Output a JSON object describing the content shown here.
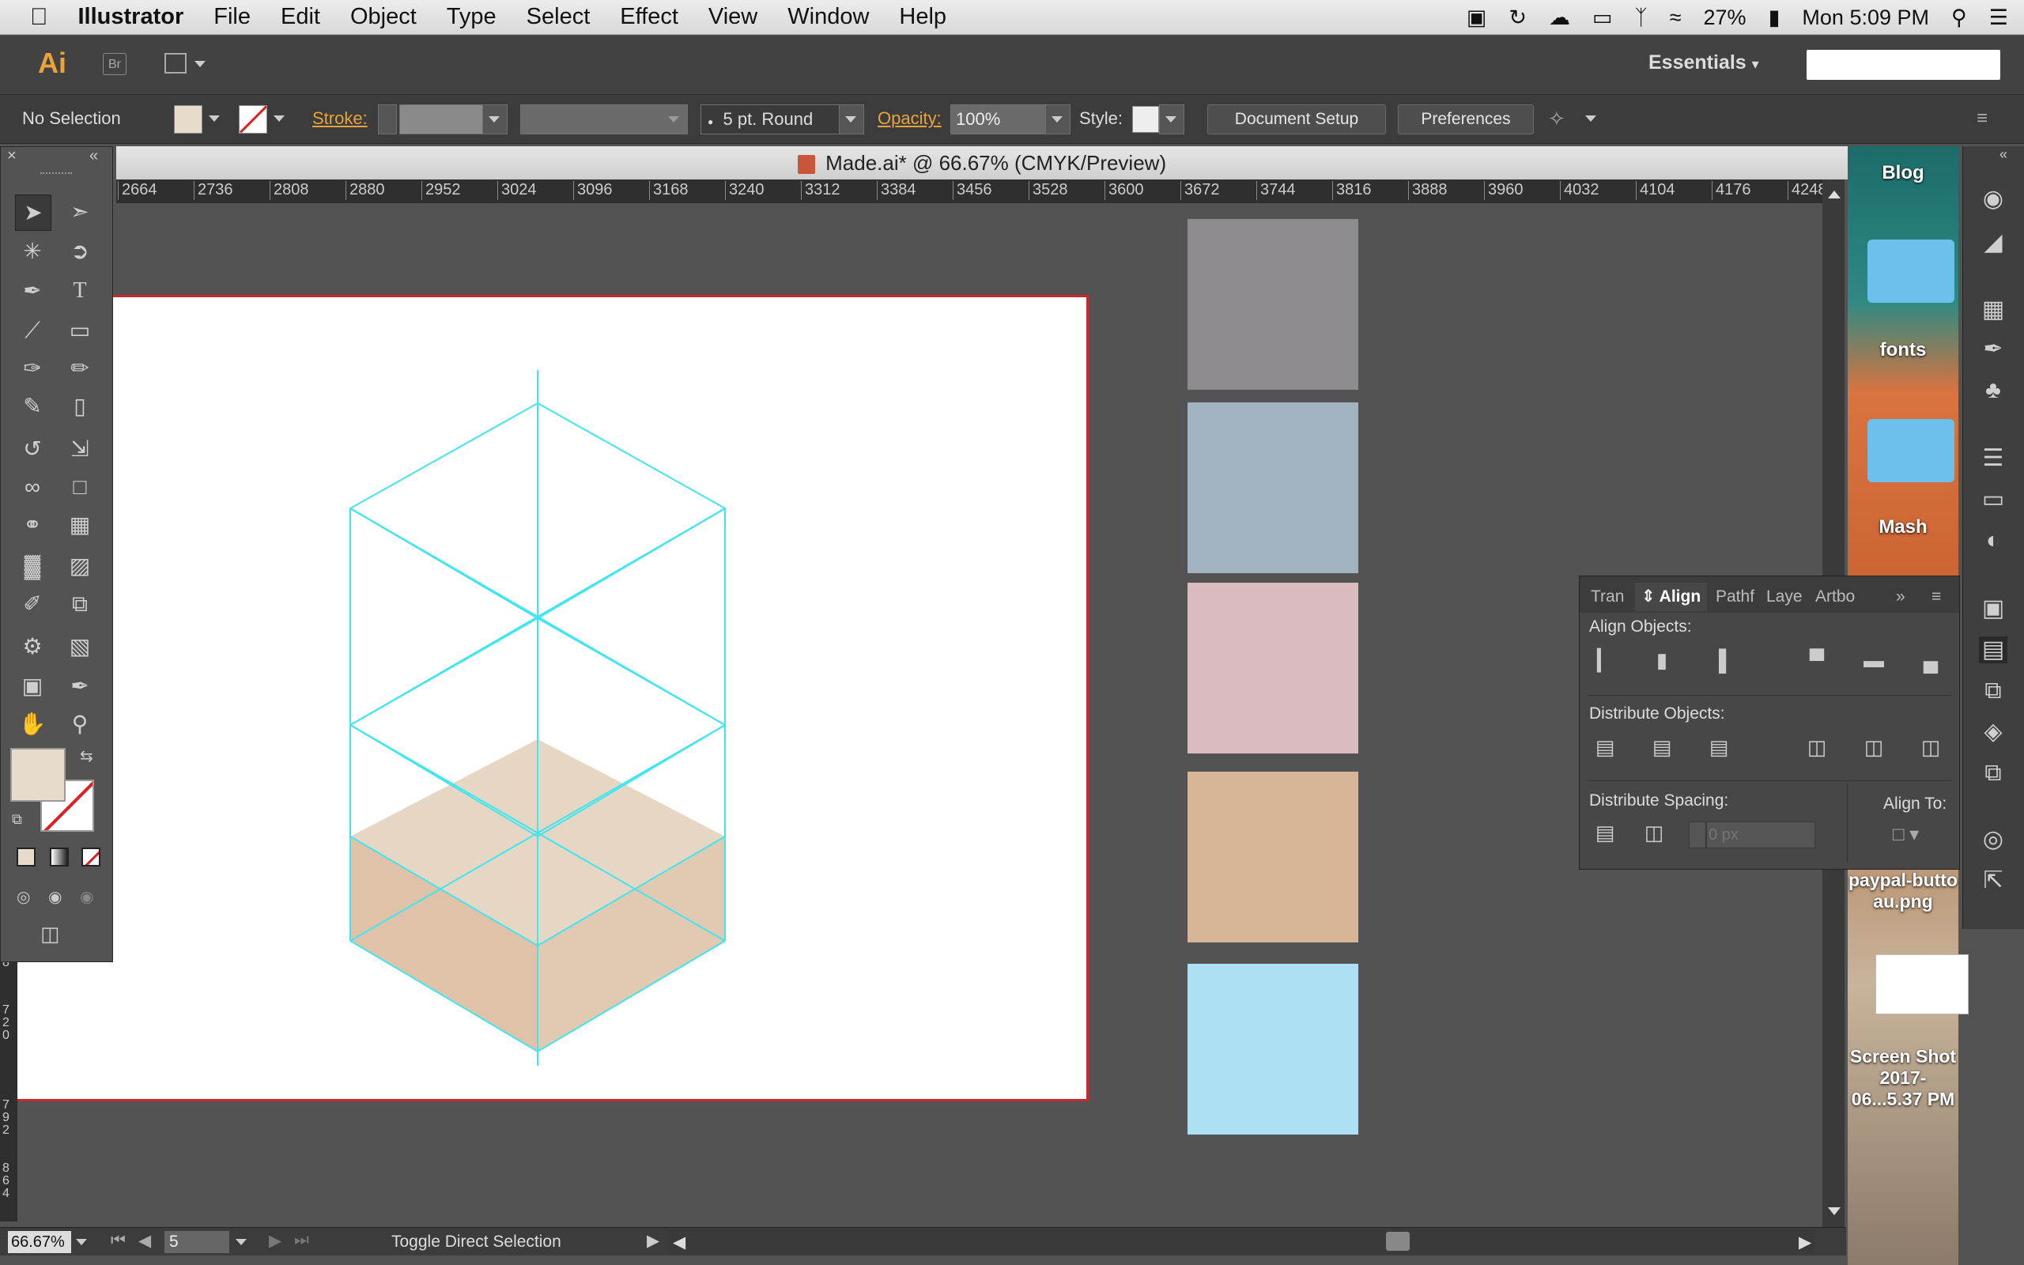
{
  "menubar": {
    "apple_icon": "apple-icon",
    "app_name": "Illustrator",
    "items": [
      "File",
      "Edit",
      "Object",
      "Type",
      "Select",
      "Effect",
      "View",
      "Window",
      "Help"
    ],
    "battery": "27%",
    "clock": "Mon 5:09 PM"
  },
  "appbar": {
    "logo": "Ai",
    "bridge": "Br",
    "workspace": "Essentials"
  },
  "control": {
    "selection": "No Selection",
    "stroke_label": "Stroke:",
    "brush": "5 pt. Round",
    "opacity_label": "Opacity:",
    "opacity_value": "100%",
    "style_label": "Style:",
    "doc_setup": "Document Setup",
    "preferences": "Preferences",
    "fill_color": "#e7dccb"
  },
  "document": {
    "title": "Made.ai* @ 66.67% (CMYK/Preview)",
    "ruler_ticks": [
      "2664",
      "2736",
      "2808",
      "2880",
      "2952",
      "3024",
      "3096",
      "3168",
      "3240",
      "3312",
      "3384",
      "3456",
      "3528",
      "3600",
      "3672",
      "3744",
      "3816",
      "3888",
      "3960",
      "4032",
      "4104",
      "4176",
      "4248"
    ],
    "vruler_ticks": [
      "8",
      "720",
      "792",
      "864"
    ]
  },
  "swatches": [
    {
      "color": "#8d8b8e"
    },
    {
      "color": "#a0b3be"
    },
    {
      "color": "#d9bbc0"
    },
    {
      "color": "#d6b696"
    },
    {
      "color": "#aee0f3"
    }
  ],
  "status": {
    "zoom": "66.67%",
    "artboard": "5",
    "tool_hint": "Toggle Direct Selection"
  },
  "align_panel": {
    "tabs": [
      "Tran",
      "Align",
      "Pathf",
      "Laye",
      "Artbo"
    ],
    "active_tab": "Align",
    "align_objects": "Align Objects:",
    "distribute_objects": "Distribute Objects:",
    "distribute_spacing": "Distribute Spacing:",
    "align_to": "Align To:",
    "spacing_placeholder": "0 px"
  },
  "desktop": {
    "items": [
      "Blog",
      "fonts",
      "Mash",
      "paypal-butto au.png",
      "Screen Shot 2017-06...5.37 PM"
    ]
  }
}
